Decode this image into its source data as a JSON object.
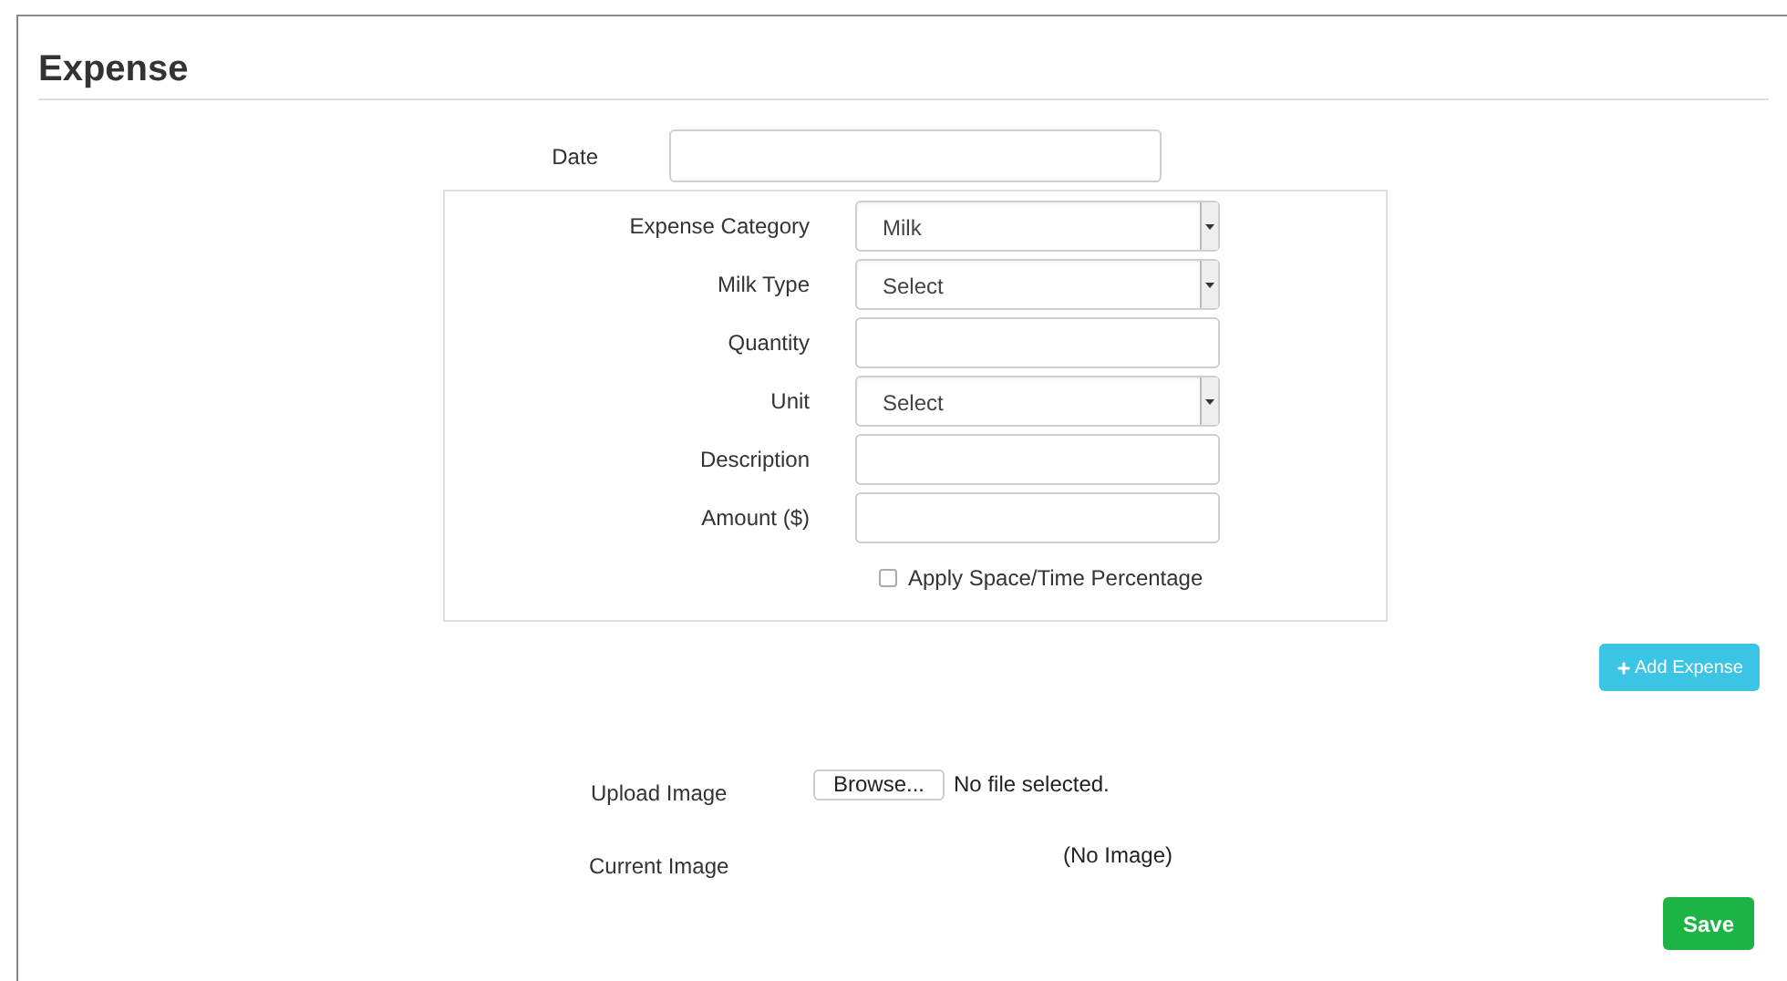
{
  "title": "Expense",
  "date": {
    "label": "Date"
  },
  "fields": [
    {
      "label": "Expense Category",
      "kind": "select",
      "value": "Milk"
    },
    {
      "label": "Milk Type",
      "kind": "select",
      "value": "Select"
    },
    {
      "label": "Quantity",
      "kind": "text"
    },
    {
      "label": "Unit",
      "kind": "select",
      "value": "Select"
    },
    {
      "label": "Description",
      "kind": "text"
    },
    {
      "label": "Amount ($)",
      "kind": "text"
    }
  ],
  "apply_percentage": {
    "label": "Apply Space/Time Percentage",
    "checked": false
  },
  "add_button": "Add Expense",
  "upload": {
    "label": "Upload Image",
    "button": "Browse...",
    "status": "No file selected."
  },
  "current_image": {
    "label": "Current Image",
    "value": "(No Image)"
  },
  "save_button": "Save"
}
